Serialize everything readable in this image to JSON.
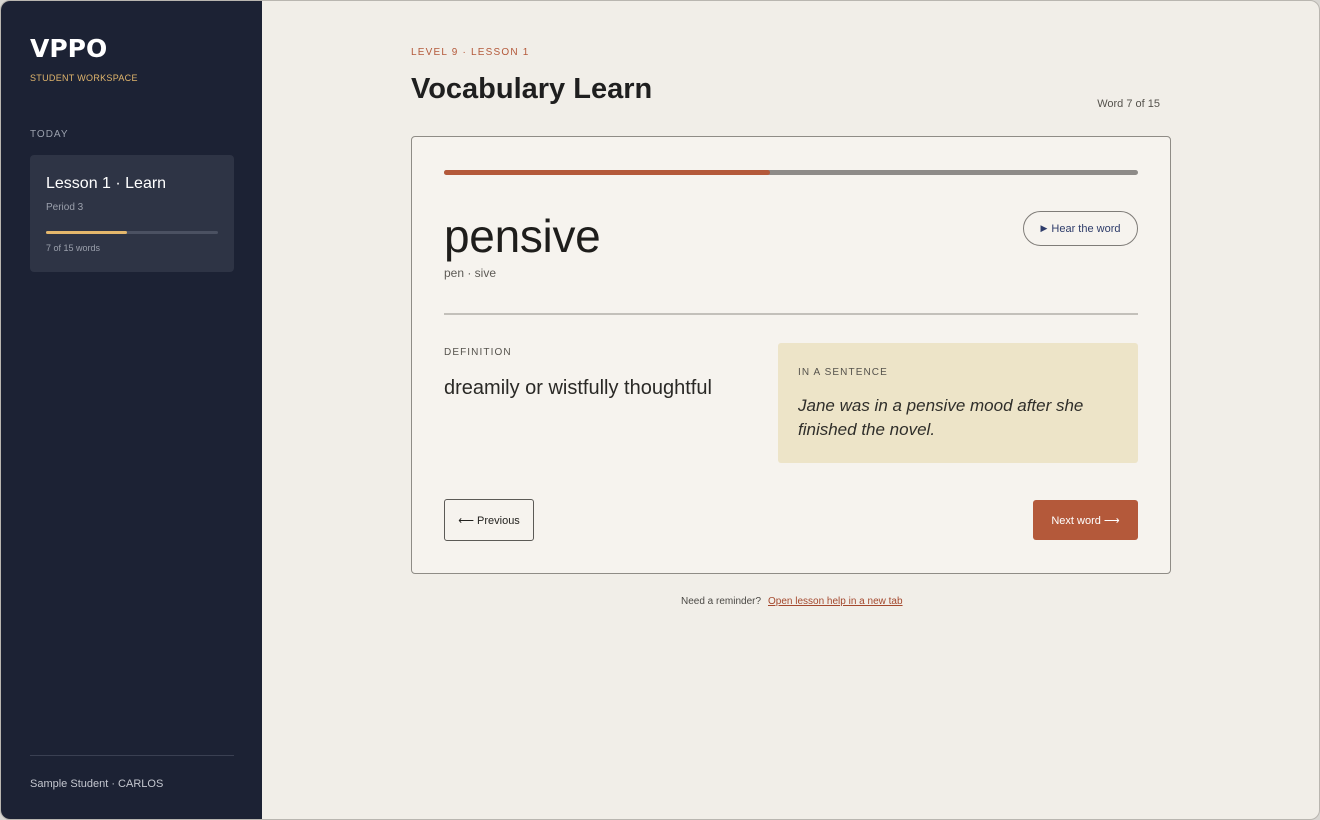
{
  "sidebar": {
    "brand": "VPPO",
    "brand_sub": "STUDENT WORKSPACE",
    "section_label": "TODAY",
    "lesson": {
      "title": "Lesson 1 · Learn",
      "period": "Period 3",
      "progress_fraction": 0.47,
      "progress_text": "7 of 15 words"
    },
    "student": "Sample Student · CARLOS"
  },
  "header": {
    "eyebrow": "LEVEL 9 · LESSON 1",
    "title": "Vocabulary Learn",
    "counter": "Word 7 of 15"
  },
  "card": {
    "progress_fraction": 0.47,
    "word": "pensive",
    "syllables": "pen · sive",
    "hear_label": "Hear the word",
    "hear_icon": "play-icon",
    "definition_label": "DEFINITION",
    "definition": "dreamily or wistfully thoughtful",
    "sentence_label": "IN A SENTENCE",
    "sentence": "Jane was in a pensive mood after she finished the novel.",
    "prev_label": "⟵ Previous",
    "next_label": "Next word ⟶"
  },
  "footer": {
    "note": "Need a reminder?",
    "link": "Open lesson help in a new tab"
  },
  "colors": {
    "accent": "#b4593a",
    "sidebar": "#1c2234",
    "highlight": "#e4b76c",
    "sentence_bg": "#ede4c8"
  }
}
